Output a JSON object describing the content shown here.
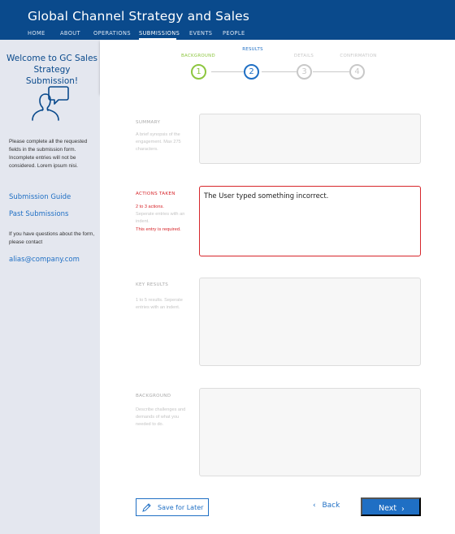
{
  "header": {
    "title": "Global Channel Strategy and Sales",
    "nav": [
      {
        "label": "HOME"
      },
      {
        "label": "ABOUT"
      },
      {
        "label": "OPERATIONS"
      },
      {
        "label": "SUBMISSIONS",
        "active": true
      },
      {
        "label": "EVENTS"
      },
      {
        "label": "PEOPLE"
      }
    ]
  },
  "sidebar": {
    "welcome": "Welcome to GC Sales Strategy Submission!",
    "icon": "users-chat-icon",
    "intro": "Please complete all the requested fields in the submission form. Incomplete entries will not be considered. Lorem ipsum nisi.",
    "links": [
      {
        "label": "Submission Guide"
      },
      {
        "label": "Past Submissions"
      }
    ],
    "questions": "If you have questions about the form, please contact",
    "contact_email": "alias@company.com"
  },
  "steps": [
    {
      "label": "BACKGROUND",
      "number": "1",
      "state": "done"
    },
    {
      "label": "RESULTS",
      "number": "2",
      "state": "active"
    },
    {
      "label": "DETAILS",
      "number": "3",
      "state": "future"
    },
    {
      "label": "CONFIRMATION",
      "number": "4",
      "state": "future"
    }
  ],
  "colors": {
    "header_bg": "#0a4a8c",
    "accent": "#1f6fc4",
    "done": "#8dc63f",
    "error": "#d7262b",
    "sidebar_bg": "#e4e7ef"
  },
  "form": {
    "summary": {
      "label": "SUMMARY",
      "help": "A brief synopsis of the engagement. Max 275 characters.",
      "value": ""
    },
    "actions_taken": {
      "label": "ACTIONS TAKEN",
      "count_hint": "2 to 3 actions.",
      "help": "Seperate entries with an indent.",
      "error": "This entry is required.",
      "value": "The User typed something incorrect."
    },
    "key_results": {
      "label": "KEY RESULTS",
      "help": "1 to 5 results. Seperate entries with an indent.",
      "value": ""
    },
    "background": {
      "label": "BACKGROUND",
      "help": "Describe challenges and demands of what you needed to do.",
      "value": ""
    }
  },
  "footer": {
    "save_label": "Save for Later",
    "back_label": "Back",
    "next_label": "Next"
  }
}
